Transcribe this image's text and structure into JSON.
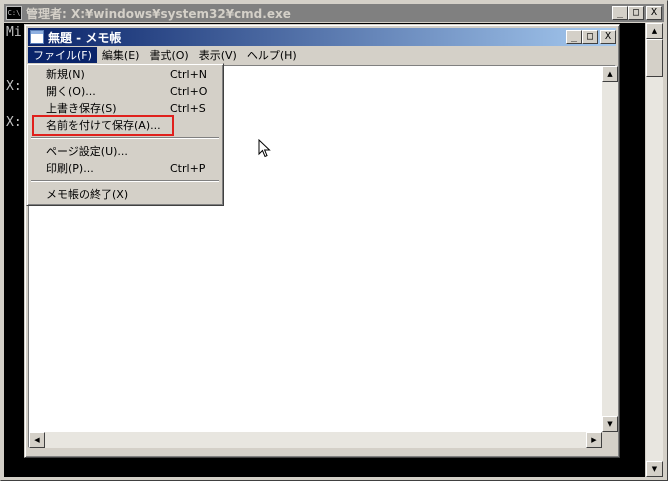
{
  "cmd": {
    "title": "管理者: X:¥windows¥system32¥cmd.exe",
    "icon_text": "C:\\",
    "console_lines": [
      "Mi",
      "X:",
      "X:"
    ],
    "caption": {
      "min": "_",
      "max": "□",
      "close": "X"
    }
  },
  "notepad": {
    "title": "無題 - メモ帳",
    "caption": {
      "min": "_",
      "max": "□",
      "close": "X"
    },
    "menubar": [
      {
        "label": "ファイル(F)"
      },
      {
        "label": "編集(E)"
      },
      {
        "label": "書式(O)"
      },
      {
        "label": "表示(V)"
      },
      {
        "label": "ヘルプ(H)"
      }
    ]
  },
  "file_menu": {
    "items": [
      {
        "label": "新規(N)",
        "accel": "Ctrl+N"
      },
      {
        "label": "開く(O)...",
        "accel": "Ctrl+O"
      },
      {
        "label": "上書き保存(S)",
        "accel": "Ctrl+S"
      },
      {
        "label": "名前を付けて保存(A)...",
        "accel": ""
      },
      {
        "label": "ページ設定(U)...",
        "accel": ""
      },
      {
        "label": "印刷(P)...",
        "accel": "Ctrl+P"
      },
      {
        "label": "メモ帳の終了(X)",
        "accel": ""
      }
    ]
  },
  "icons": {
    "cmd": "console-app-icon",
    "notepad": "notepad-icon",
    "cursor": "mouse-pointer-icon"
  },
  "colors": {
    "active_title": "#0a246a",
    "inactive_title": "#808080",
    "highlight_box": "#e0201c",
    "face": "#d4d0c8"
  }
}
